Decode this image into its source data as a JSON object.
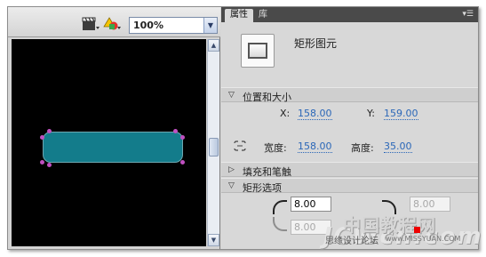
{
  "toolbar": {
    "zoom_value": "100%",
    "icons": [
      "clapperboard-icon",
      "shapes-icon",
      "dropdown-arrow-icon"
    ]
  },
  "properties_panel": {
    "tabs": [
      {
        "label": "属性",
        "active": true
      },
      {
        "label": "库",
        "active": false
      }
    ],
    "object_type": "矩形图元",
    "position_size": {
      "title": "位置和大小",
      "x_label": "X:",
      "x_value": "158.00",
      "y_label": "Y:",
      "y_value": "159.00",
      "width_label": "宽度:",
      "width_value": "158.00",
      "height_label": "高度:",
      "height_value": "35.00"
    },
    "fill_stroke": {
      "title": "填充和笔触"
    },
    "rect_options": {
      "title": "矩形选项",
      "corner_tl": "8.00",
      "corner_tr": "8.00",
      "corner_bl": "8.00"
    }
  },
  "watermark": {
    "chinese": "中国教程网",
    "latin": "JCWcn.com",
    "forum": "思缘设计论坛",
    "url": "www.MISSYUAN.COM"
  },
  "colors": {
    "canvas_bg": "#000000",
    "shape_fill": "#137c8b",
    "link_blue": "#2b67b8"
  }
}
